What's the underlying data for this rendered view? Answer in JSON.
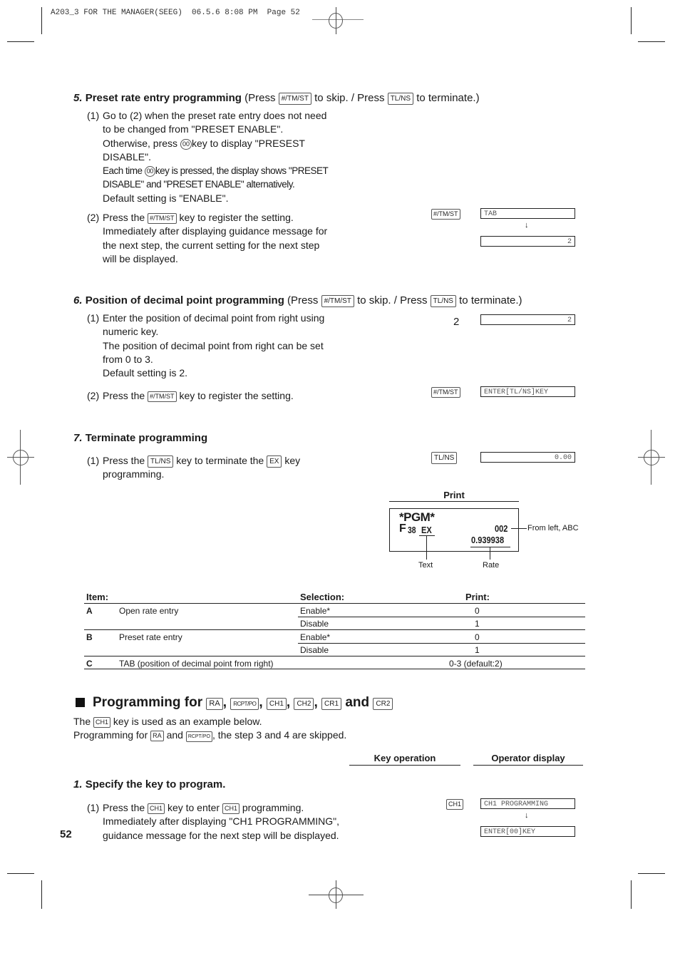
{
  "print_header": {
    "text": "A203_3 FOR THE MANAGER(SEEG)  06.5.6 8:08 PM  Page 52"
  },
  "keys": {
    "tm_st": "#/TM/ST",
    "tl_ns": "TL/NS",
    "double_zero": "00",
    "ex": "EX",
    "ra": "RA",
    "rcpt_po": "RCPT/PO",
    "ch1": "CH1",
    "ch2": "CH2",
    "cr1": "CR1",
    "cr2": "CR2"
  },
  "step5": {
    "number": "5.",
    "title": "Preset rate entry programming",
    "press": "(Press",
    "to_skip": "to skip. / Press",
    "to_terminate": "to terminate.)",
    "sub1": {
      "num": "(1)",
      "line1": "Go to (2) when the preset rate entry does not need",
      "line2": "to be changed from \"PRESET ENABLE\".",
      "line3a": "Otherwise, press",
      "line3b": "key to display \"PRESEST",
      "line4": "DISABLE\".",
      "line5a": "Each time",
      "line5b": "key is pressed, the display shows \"PRESET",
      "line6": "DISABLE\" and \"PRESET ENABLE\" alternatively.",
      "line7": "Default setting is \"ENABLE\"."
    },
    "sub2": {
      "num": "(2)",
      "line1a": "Press the",
      "line1b": "key to register the setting.",
      "line2": "Immediately after displaying guidance message for",
      "line3": "the next step, the current setting for the next step",
      "line4": "will be displayed."
    },
    "key_op": "#/TM/ST",
    "display1": "TAB",
    "display2": "2"
  },
  "step6": {
    "number": "6.",
    "title": "Position of decimal point programming",
    "press": "(Press",
    "to_skip": "to skip. / Press",
    "to_terminate": "to terminate.)",
    "sub1": {
      "num": "(1)",
      "line1": "Enter the position of decimal point from right using",
      "line2": "numeric key.",
      "line3": "The position of decimal point from right can be set",
      "line4": "from 0 to 3.",
      "line5": "Default setting is 2."
    },
    "key_op1": "2",
    "display1": "2",
    "sub2": {
      "num": "(2)",
      "line1a": "Press the",
      "line1b": "key to register the setting."
    },
    "key_op2": "#/TM/ST",
    "display2": "ENTER[TL/NS]KEY"
  },
  "step7": {
    "number": "7.",
    "title": "Terminate programming",
    "sub1": {
      "num": "(1)",
      "line1a": "Press the",
      "line1b": "key to terminate the",
      "line1c": "key",
      "line2": "programming."
    },
    "key_op": "TL/NS",
    "display": "0.00"
  },
  "print_sample": {
    "title": "Print",
    "line1": "*PGM*",
    "f_label": "F",
    "f_num": "38",
    "text_value": "EX",
    "code": "002",
    "rate": "0.939938",
    "callout_code": "From left, ABC",
    "callout_text": "Text",
    "callout_rate": "Rate"
  },
  "settings_table": {
    "headers": {
      "item": "Item:",
      "selection": "Selection:",
      "print": "Print:"
    },
    "rows": [
      {
        "letter": "A",
        "item": "Open rate entry",
        "selection": "Enable*",
        "print": "0"
      },
      {
        "letter": "",
        "item": "",
        "selection": "Disable",
        "print": "1"
      },
      {
        "letter": "B",
        "item": "Preset rate entry",
        "selection": "Enable*",
        "print": "0"
      },
      {
        "letter": "",
        "item": "",
        "selection": "Disable",
        "print": "1"
      },
      {
        "letter": "C",
        "item": "TAB (position of decimal point from right)",
        "selection": "",
        "print": "0-3 (default:2)"
      }
    ]
  },
  "section": {
    "title": "Programming for",
    "and": "and",
    "comma": ",",
    "intro1a": "The",
    "intro1b": "key is used as an example below.",
    "intro2a": "Programming for",
    "intro2b": "and",
    "intro2c": ", the step 3 and 4 are skipped.",
    "col_key_operation": "Key operation",
    "col_operator_display": "Operator display"
  },
  "sec_step1": {
    "number": "1.",
    "title": "Specify the key to program.",
    "sub1": {
      "num": "(1)",
      "line1a": "Press the",
      "line1b": "key to enter",
      "line1c": "programming.",
      "line2": "Immediately after displaying \"CH1 PROGRAMMING\",",
      "line3": "guidance message for the next step will be displayed."
    },
    "key_op": "CH1",
    "display1": "CH1 PROGRAMMING",
    "display2": "ENTER[00]KEY"
  },
  "page_number": "52"
}
